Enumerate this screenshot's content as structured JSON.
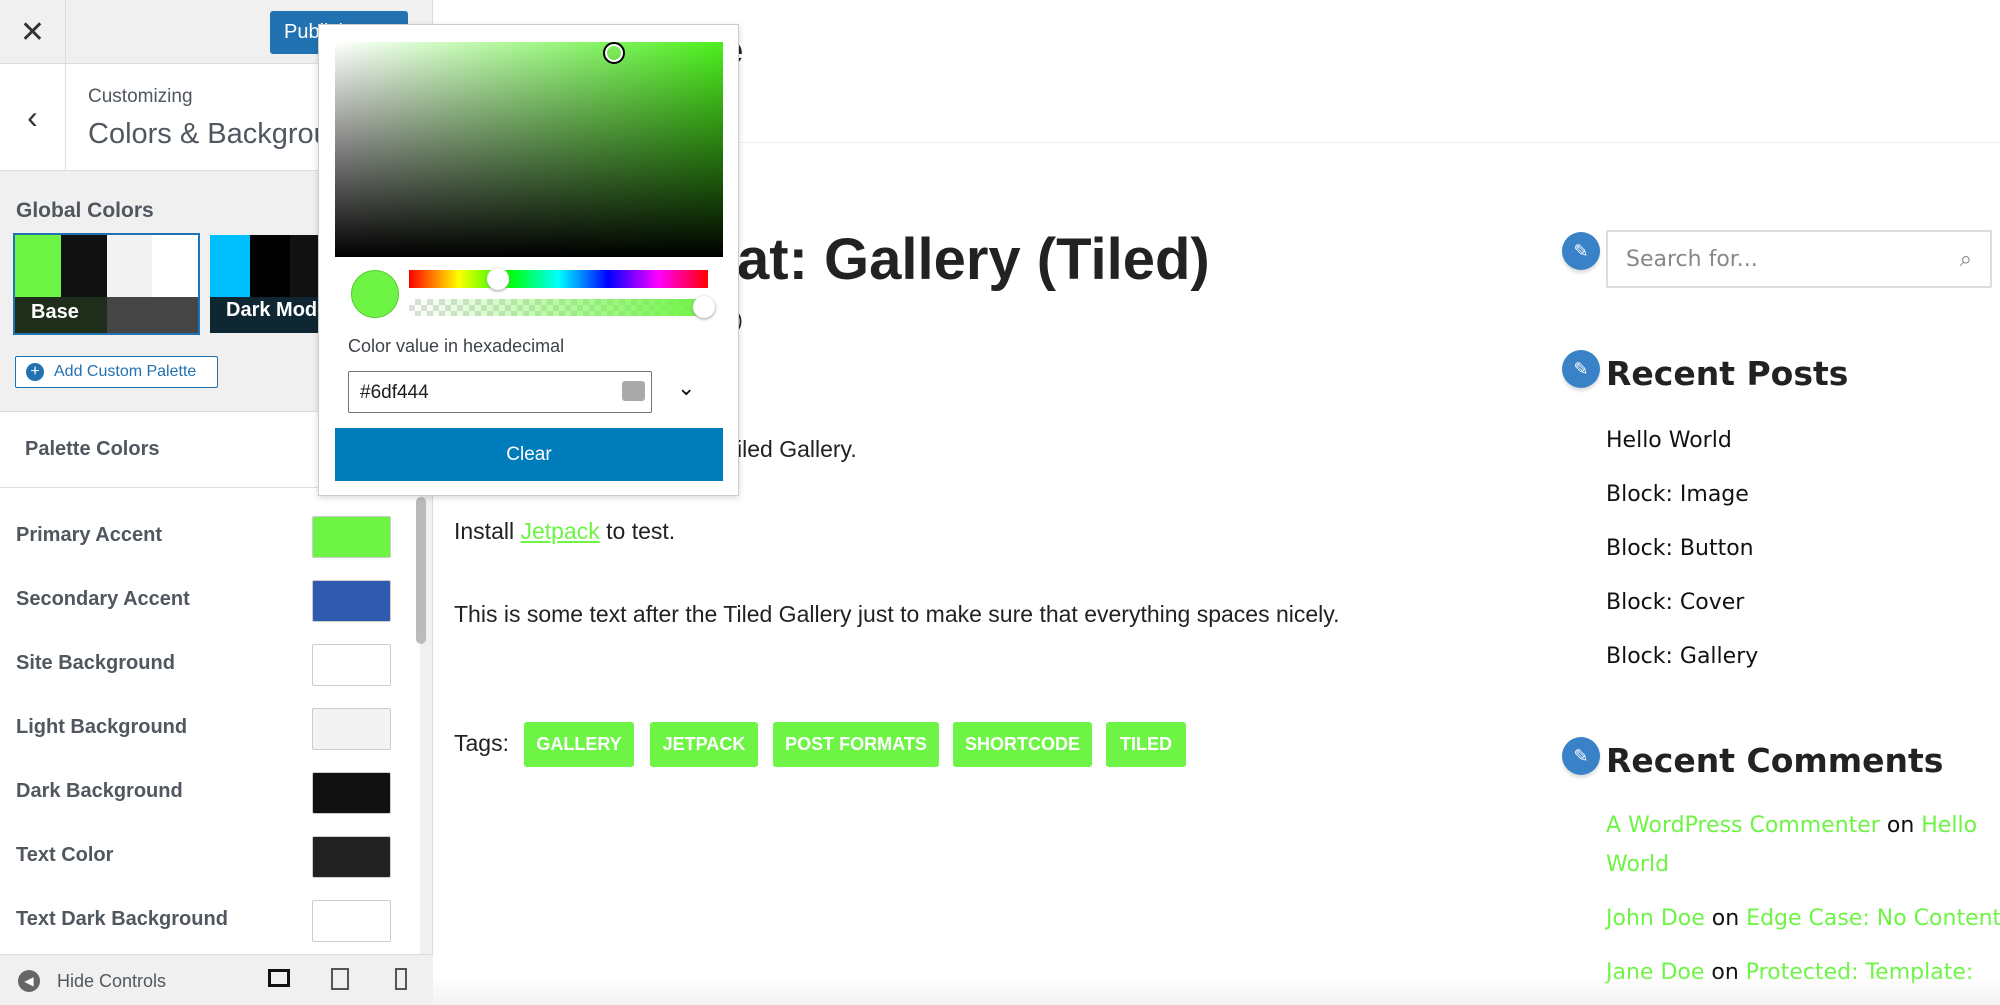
{
  "colors": {
    "accent": "#6df444",
    "publish": "#2271b1",
    "clear": "#007cba"
  },
  "sidebar": {
    "close_icon": "close-icon",
    "publish_label": "Publish",
    "customizing": "Customizing",
    "section_title": "Colors & Backgrounds",
    "global_colors": "Global Colors",
    "palettes": [
      {
        "label": "Base",
        "colors": [
          "#6df444",
          "#111111",
          "#f3f3f3",
          "#ffffff"
        ]
      },
      {
        "label": "Dark Mode",
        "colors": [
          "#00bfff",
          "#000000",
          "#111111"
        ]
      }
    ],
    "add_palette": "Add Custom Palette",
    "palette_colors": "Palette Colors",
    "rows": [
      {
        "label": "Primary Accent",
        "color": "#6df444"
      },
      {
        "label": "Secondary Accent",
        "color": "#2f5aae"
      },
      {
        "label": "Site Background",
        "color": "#ffffff"
      },
      {
        "label": "Light Background",
        "color": "#f3f3f3"
      },
      {
        "label": "Dark Background",
        "color": "#111111"
      },
      {
        "label": "Text Color",
        "color": "#222222"
      },
      {
        "label": "Text Dark Background",
        "color": "#ffffff"
      }
    ],
    "hide_controls": "Hide Controls"
  },
  "picker": {
    "label": "Color value in hexadecimal",
    "value": "#6df444",
    "clear": "Clear"
  },
  "main": {
    "title_partial": "at: Gallery (Tiled)",
    "header_partial": "e",
    "paren_partial": ")",
    "para1_partial": "iled Gallery.",
    "install_pre": "Install",
    "install_link": "Jetpack",
    "install_post": "to test.",
    "para2": "This is some text after the Tiled Gallery just to make sure that everything spaces nicely.",
    "tags_label": "Tags:",
    "tags": [
      "GALLERY",
      "JETPACK",
      "POST FORMATS",
      "SHORTCODE",
      "TILED"
    ]
  },
  "widgets": {
    "search_placeholder": "Search for...",
    "recent_posts": "Recent Posts",
    "posts": [
      "Hello World",
      "Block: Image",
      "Block: Button",
      "Block: Cover",
      "Block: Gallery"
    ],
    "recent_comments": "Recent Comments",
    "comments": [
      {
        "author": "A WordPress Commenter",
        "on": "on",
        "post1": "Hello",
        "post2": "World"
      },
      {
        "author": "John Doe",
        "on": "on",
        "post": "Edge Case: No Content"
      },
      {
        "author": "Jane Doe",
        "on": "on",
        "post": "Protected: Template:"
      }
    ]
  }
}
